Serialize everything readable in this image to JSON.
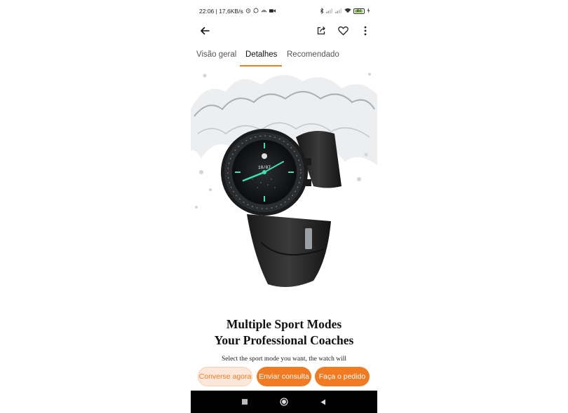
{
  "status_bar": {
    "time_speed": "22:06 | 17,6KB/s",
    "battery_level": "87",
    "icons": [
      "alarm-icon",
      "whatsapp-icon",
      "cast-icon",
      "video-icon",
      "bluetooth-icon",
      "signal-icon",
      "signal-icon",
      "wifi-icon",
      "battery-icon",
      "charging-icon"
    ]
  },
  "top_bar": {
    "icons": [
      "back-arrow-icon",
      "share-icon",
      "heart-icon",
      "more-vertical-icon"
    ]
  },
  "tabs": [
    {
      "label": "Visão geral",
      "active": false
    },
    {
      "label": "Detalhes",
      "active": true
    },
    {
      "label": "Recomendado",
      "active": false
    }
  ],
  "product": {
    "watch_time": "10/07",
    "headline_line1": "Multiple Sport Modes",
    "headline_line2": "Your Professional Coaches",
    "subtext": "Select the sport mode you want, the watch will"
  },
  "actions": {
    "chat_label": "Converse agora",
    "inquiry_label": "Enviar consulta",
    "order_label": "Faça o pedido"
  },
  "colors": {
    "accent": "#f07b22",
    "chat_bg": "#fde7da",
    "nav_bg": "#000000"
  }
}
